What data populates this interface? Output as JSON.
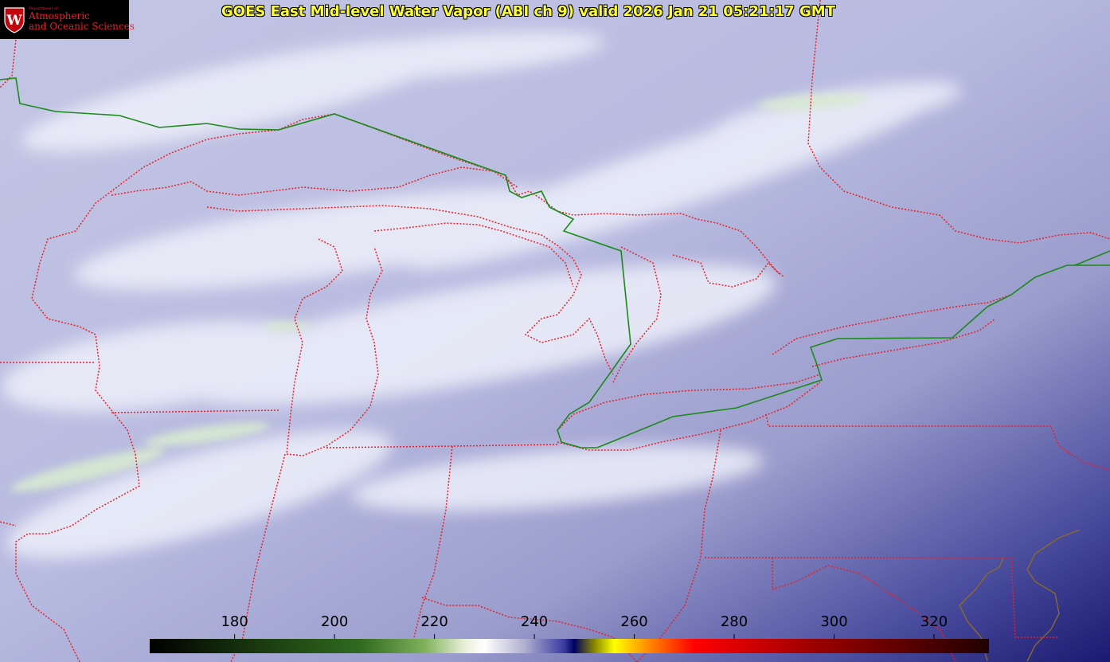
{
  "title": "GOES East Mid-level Water Vapor (ABI ch 9)  valid 2026 Jan 21 05:21:17 GMT",
  "logo": {
    "small": "Department of",
    "line1": "Atmospheric",
    "line2": "and Oceanic Sciences",
    "shield_letter": "W"
  },
  "colorbar": {
    "ticks": [
      "180",
      "200",
      "220",
      "240",
      "260",
      "280",
      "300",
      "320"
    ],
    "tick_values": [
      180,
      200,
      220,
      240,
      260,
      280,
      300,
      320
    ],
    "range": [
      163,
      331
    ],
    "stops": [
      {
        "v": 163,
        "c": "#000000"
      },
      {
        "v": 185,
        "c": "#1a3a0f"
      },
      {
        "v": 205,
        "c": "#2f6a1f"
      },
      {
        "v": 218,
        "c": "#7fb05a"
      },
      {
        "v": 226,
        "c": "#e8f0d8"
      },
      {
        "v": 230,
        "c": "#ffffff"
      },
      {
        "v": 238,
        "c": "#b0b0d0"
      },
      {
        "v": 246,
        "c": "#3a3aa0"
      },
      {
        "v": 248,
        "c": "#000060"
      },
      {
        "v": 252,
        "c": "#888800"
      },
      {
        "v": 256,
        "c": "#ffff00"
      },
      {
        "v": 263,
        "c": "#ff8800"
      },
      {
        "v": 272,
        "c": "#ff0000"
      },
      {
        "v": 295,
        "c": "#a00000"
      },
      {
        "v": 331,
        "c": "#200000"
      }
    ]
  },
  "colors": {
    "border_state": "#e8202a",
    "border_intl": "#1a8a1a",
    "coast": "#8a6a2a",
    "background_dark": "#1a1a70"
  }
}
